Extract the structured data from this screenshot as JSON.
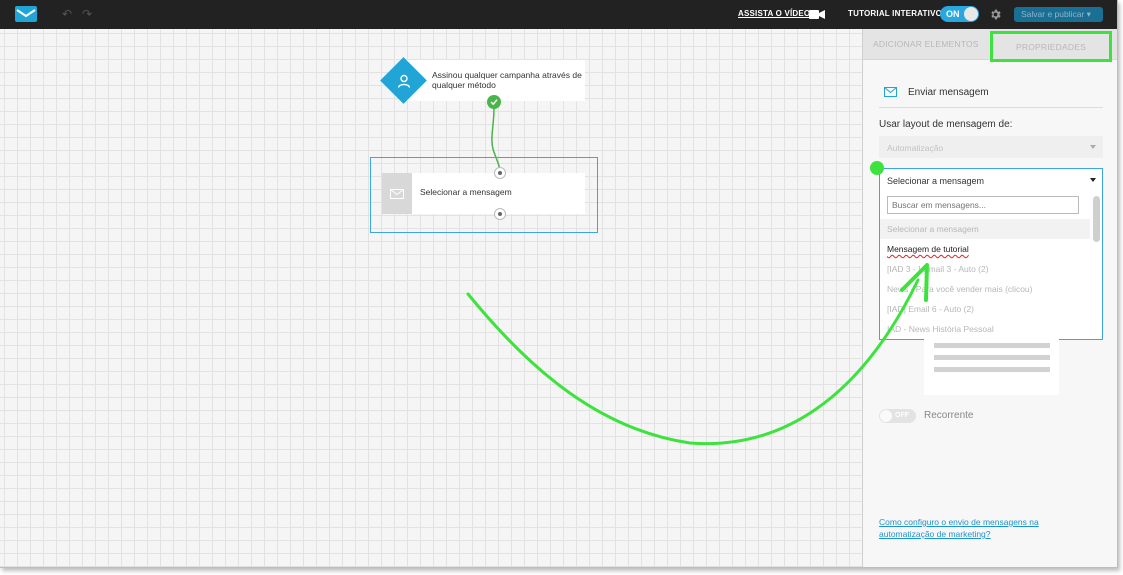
{
  "topbar": {
    "watch_video": "ASSISTA O VÍDEO",
    "tutorial_label": "TUTORIAL INTERATIVO",
    "tutorial_toggle": "ON",
    "save_button": "Salvar e publicar ▾"
  },
  "canvas": {
    "trigger_text": "Assinou qualquer campanha através de qualquer método",
    "message_node_label": "Selecionar a mensagem"
  },
  "panel": {
    "tabs": {
      "add_elements": "ADICIONAR ELEMENTOS",
      "properties": "PROPRIEDADES"
    },
    "send_message_title": "Enviar mensagem",
    "layout_label": "Usar layout de mensagem de:",
    "layout_value": "Automatização",
    "dropdown": {
      "selected": "Selecionar a mensagem",
      "search_placeholder": "Buscar em mensagens...",
      "options": [
        "Selecionar a mensagem",
        "Mensagem de tutorial",
        "[IAD 3 - ] Email 3 - Auto (2)",
        "News - Para você vender mais (clicou)",
        "[IAD] Email 6 - Auto (2)",
        "IAD - News História Pessoal"
      ]
    },
    "recurrent_toggle": "OFF",
    "recurrent_label": "Recorrente",
    "help_link": "Como configuro o envio de mensagens na automatização de marketing?"
  },
  "colors": {
    "accent": "#21a4d6",
    "annotation": "#3ee23e",
    "success": "#4ab34a",
    "topbar": "#222222"
  }
}
